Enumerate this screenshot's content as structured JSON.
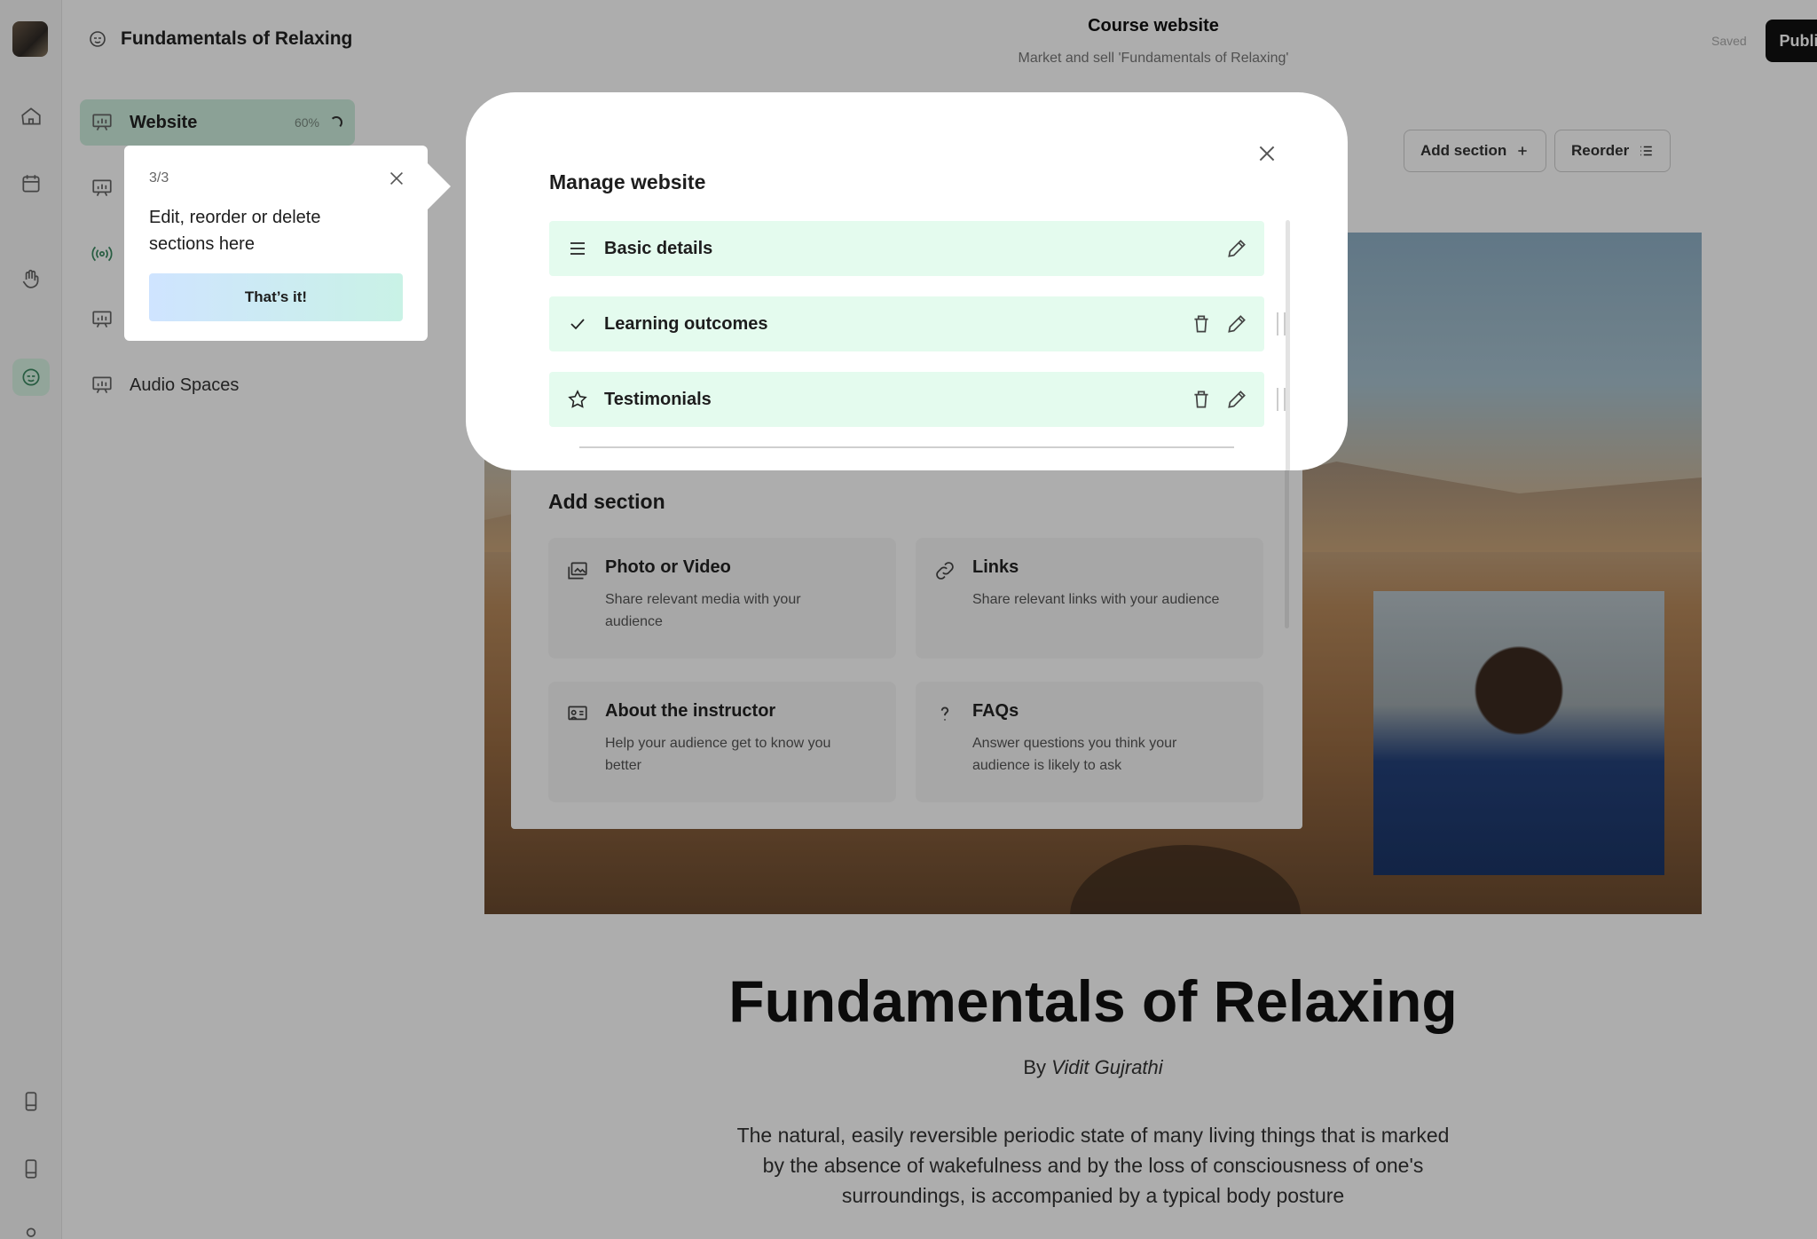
{
  "app": {
    "course_title": "Fundamentals of Relaxing",
    "header_title": "Course website",
    "header_subtitle": "Market and sell 'Fundamentals of Relaxing'",
    "saved_label": "Saved",
    "publish_label": "Publish"
  },
  "rail": {
    "icons": [
      "home-icon",
      "calendar-icon",
      "hand-wave-icon",
      "coach-icon",
      "device-icon",
      "device-icon",
      "user-icon"
    ]
  },
  "sidebar": {
    "items": [
      {
        "label": "Website",
        "progress": "60%",
        "icon": "presentation-icon",
        "active": true
      },
      {
        "label": "",
        "icon": "presentation-icon"
      },
      {
        "label": "",
        "icon": "broadcast-icon"
      },
      {
        "label": "",
        "icon": "presentation-icon"
      },
      {
        "label": "Audio Spaces",
        "icon": "presentation-icon"
      }
    ]
  },
  "toolbar": {
    "add_section_label": "Add section",
    "reorder_label": "Reorder"
  },
  "preview": {
    "heading": "Fundamentals of Relaxing",
    "by_prefix": "By",
    "author": "Vidit Gujrathi",
    "description": "The natural, easily reversible periodic state of many living things that is marked by the absence of wakefulness and by the loss of consciousness of one's surroundings, is accompanied by a typical body posture"
  },
  "modal": {
    "title": "Manage website",
    "sections": [
      {
        "label": "Basic details",
        "icon": "list-icon",
        "deletable": false,
        "reorderable": false
      },
      {
        "label": "Learning outcomes",
        "icon": "check-icon",
        "deletable": true,
        "reorderable": true
      },
      {
        "label": "Testimonials",
        "icon": "star-icon",
        "deletable": true,
        "reorderable": true
      }
    ],
    "add_section_heading": "Add section",
    "add_options": [
      {
        "title": "Photo or Video",
        "desc": "Share relevant media with your audience",
        "icon": "media-icon"
      },
      {
        "title": "Links",
        "desc": "Share relevant links with your audience",
        "icon": "link-icon"
      },
      {
        "title": "About the instructor",
        "desc": "Help your audience get to know you better",
        "icon": "instructor-icon"
      },
      {
        "title": "FAQs",
        "desc": "Answer questions you think your audience is likely to ask",
        "icon": "question-icon"
      }
    ]
  },
  "tooltip": {
    "step": "3/3",
    "message": "Edit, reorder or delete sections here",
    "button_label": "That’s it!"
  },
  "colors": {
    "accent_green": "#cdeedd",
    "row_bg": "#e4fbee",
    "publish_bg": "#111111"
  }
}
